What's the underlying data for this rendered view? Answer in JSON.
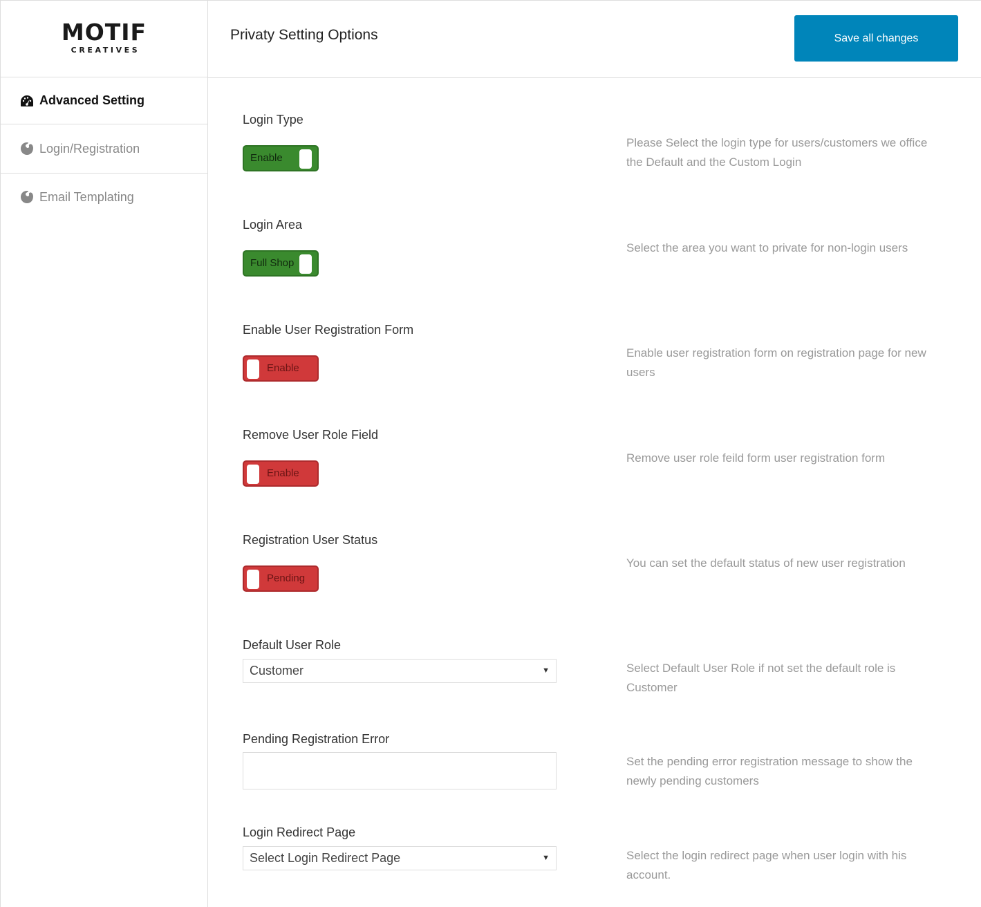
{
  "logo": {
    "main": "MOTIF",
    "sub": "CREATIVES"
  },
  "sidebar": {
    "items": [
      {
        "label": "Advanced Setting",
        "icon": "dashboard-gauge-icon",
        "active": true
      },
      {
        "label": "Login/Registration",
        "icon": "palette-icon",
        "active": false
      },
      {
        "label": "Email Templating",
        "icon": "palette-icon",
        "active": false
      }
    ]
  },
  "header": {
    "title": "Privaty Setting Options",
    "save_label": "Save all changes"
  },
  "colors": {
    "accent": "#0085ba",
    "toggle_on": "#3a8a2e",
    "toggle_off": "#d0393a",
    "desc_text": "#999999"
  },
  "settings": {
    "login_type": {
      "label": "Login Type",
      "toggle_text": "Enable",
      "state": "on",
      "description": "Please Select the login type for users/customers we office the Default and the Custom Login"
    },
    "login_area": {
      "label": "Login Area",
      "toggle_text": "Full Shop",
      "state": "on",
      "description": "Select the area you want to private for non-login users"
    },
    "enable_registration": {
      "label": "Enable User Registration Form",
      "toggle_text": "Enable",
      "state": "off",
      "description": "Enable user registration form on registration page for new users"
    },
    "remove_role_field": {
      "label": "Remove User Role Field",
      "toggle_text": "Enable",
      "state": "off",
      "description": "Remove user role feild form user registration form"
    },
    "registration_status": {
      "label": "Registration User Status",
      "toggle_text": "Pending",
      "state": "off",
      "description": "You can set the default status of new user registration"
    },
    "default_role": {
      "label": "Default User Role",
      "selected": "Customer",
      "description": "Select Default User Role if not set the default role is Customer"
    },
    "pending_error": {
      "label": "Pending Registration Error",
      "value": "",
      "description": "Set the pending error registration message to show the newly pending customers"
    },
    "redirect_page": {
      "label": "Login Redirect Page",
      "selected": "Select Login Redirect Page",
      "description": "Select the login redirect page when user login with his account."
    }
  }
}
